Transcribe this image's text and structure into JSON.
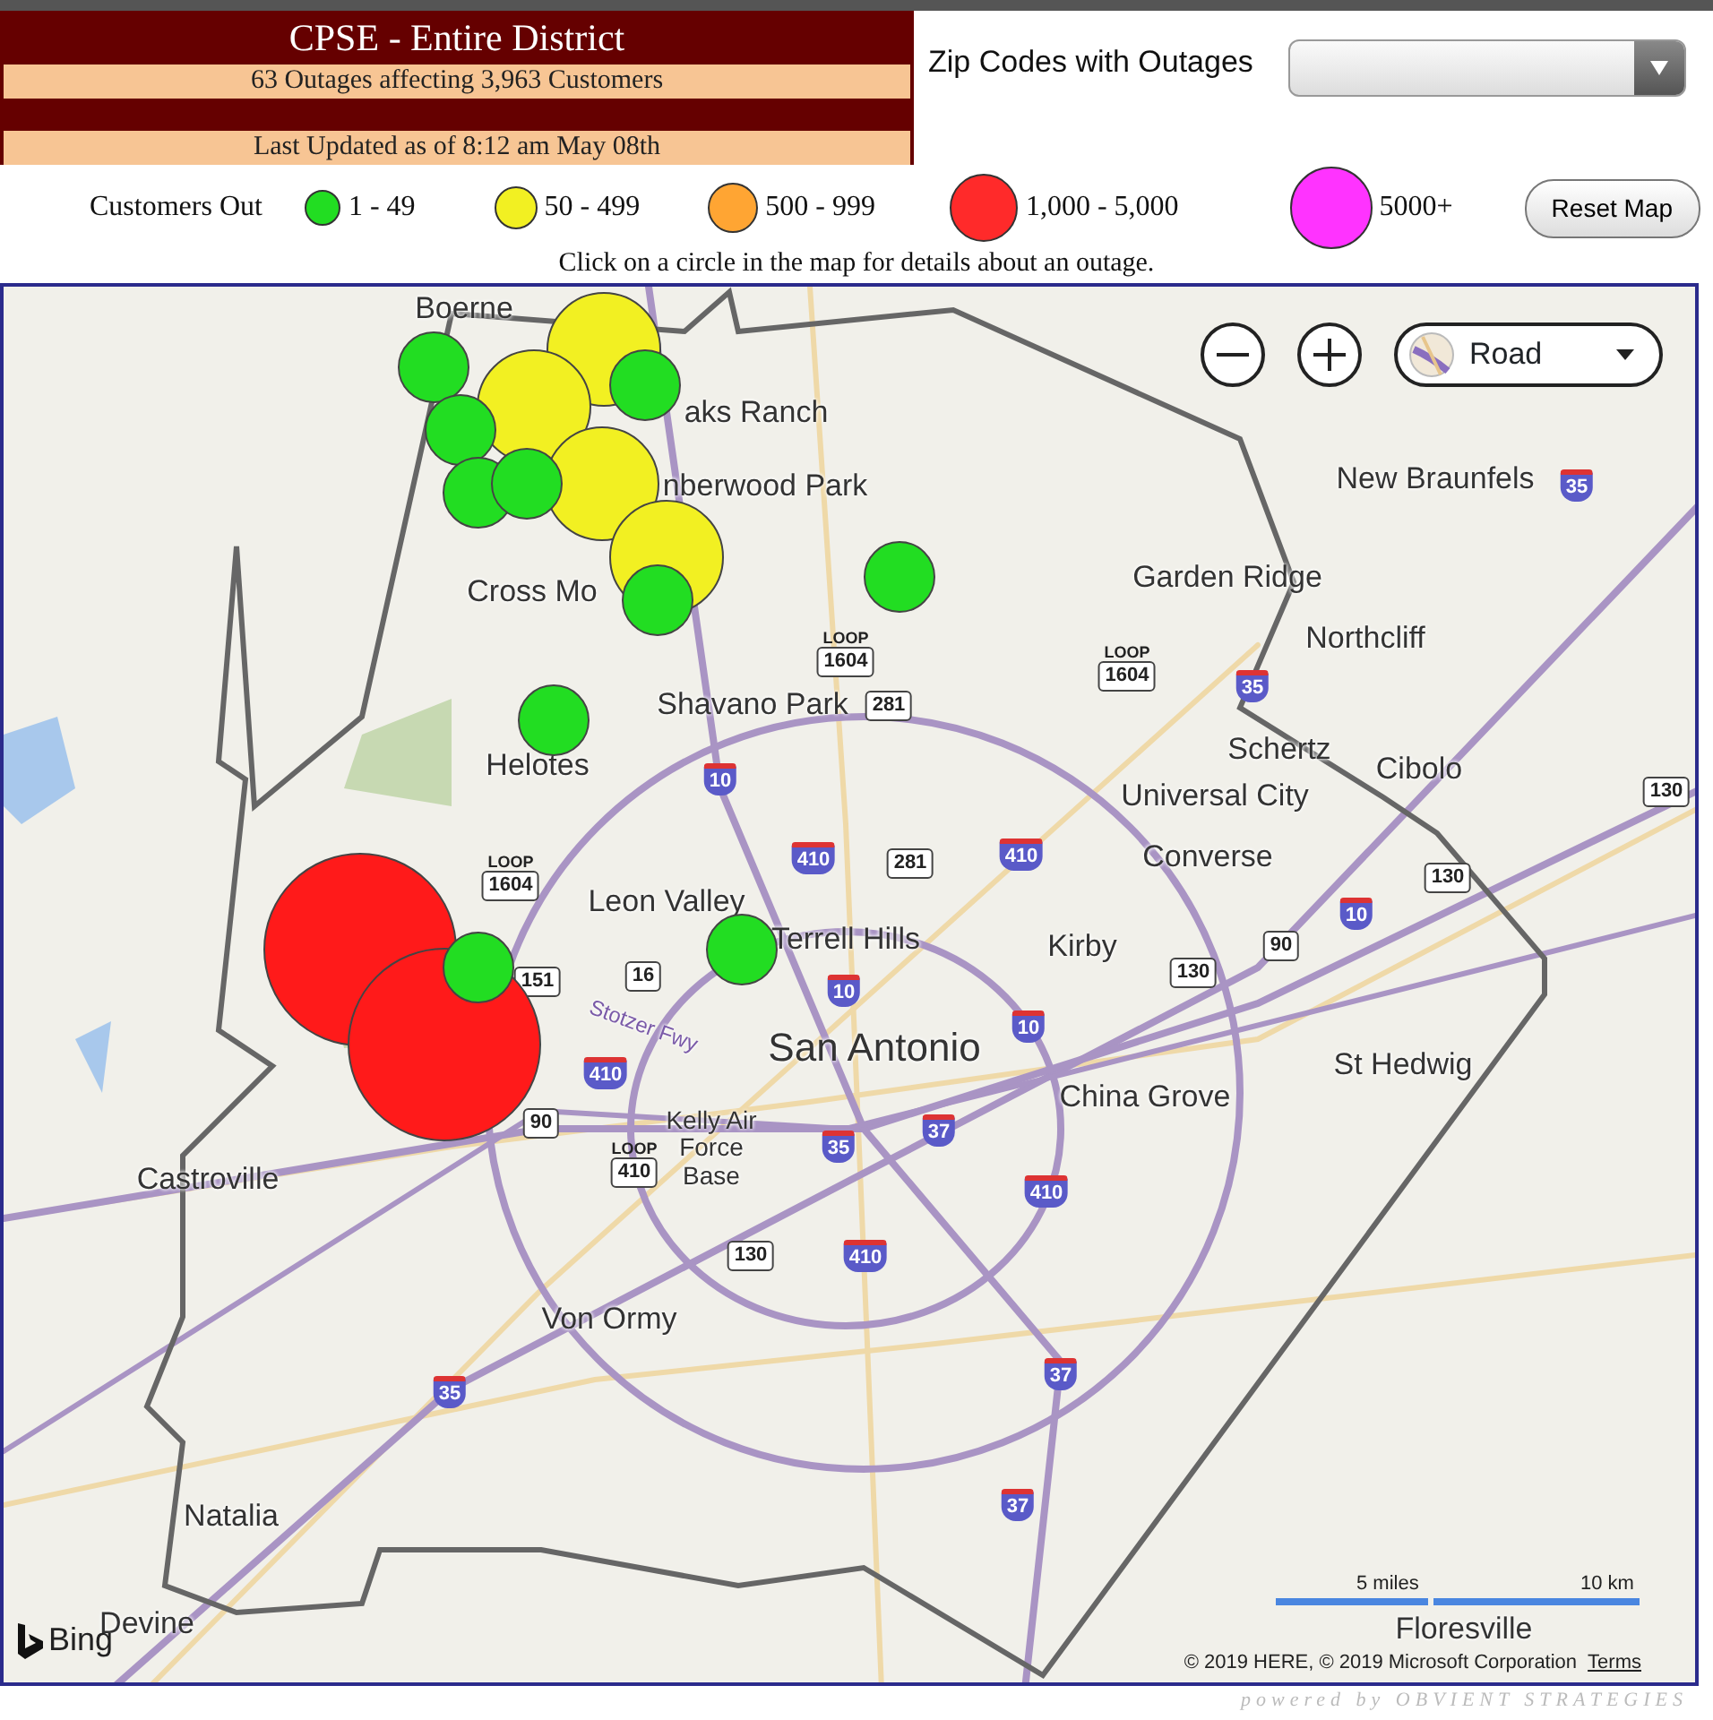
{
  "header": {
    "title": "CPSE - Entire District",
    "summary": "63 Outages affecting 3,963 Customers",
    "updated": "Last Updated as of 8:12 am May 08th"
  },
  "zip_filter": {
    "label": "Zip Codes with Outages"
  },
  "legend": {
    "title": "Customers Out",
    "items": [
      {
        "label": "1 - 49",
        "color": "#22dd22"
      },
      {
        "label": "50 - 499",
        "color": "#f2f022"
      },
      {
        "label": "500 - 999",
        "color": "#ffa533"
      },
      {
        "label": "1,000 - 5,000",
        "color": "#ff2a2a"
      },
      {
        "label": "5000+",
        "color": "#ff33ff"
      }
    ]
  },
  "reset_button": "Reset Map",
  "hint": "Click on a circle in the map for details about an outage.",
  "map": {
    "map_type": "Road",
    "places": [
      "Boerne",
      "aks Ranch",
      "nberwood Park",
      "Cross Mo",
      "Helotes",
      "New Braunfels",
      "Garden Ridge",
      "Northcliff",
      "Shavano Park",
      "Schertz",
      "Cibolo",
      "Universal City",
      "Converse",
      "Leon Valley",
      "Terrell Hills",
      "Kirby",
      "San Antonio",
      "St Hedwig",
      "China Grove",
      "Castroville",
      "Kelly Air Force Base",
      "Von Ormy",
      "Natalia",
      "Devine",
      "Floresville",
      "Stotzer Fwy"
    ],
    "shields": [
      {
        "text": "35",
        "kind": "interstate"
      },
      {
        "text": "1604",
        "kind": "loop",
        "prefix": "LOOP"
      },
      {
        "text": "1604",
        "kind": "loop",
        "prefix": "LOOP"
      },
      {
        "text": "281",
        "kind": "us"
      },
      {
        "text": "35",
        "kind": "interstate"
      },
      {
        "text": "130",
        "kind": "state"
      },
      {
        "text": "10",
        "kind": "interstate"
      },
      {
        "text": "410",
        "kind": "interstate"
      },
      {
        "text": "281",
        "kind": "us"
      },
      {
        "text": "410",
        "kind": "interstate"
      },
      {
        "text": "1604",
        "kind": "loop",
        "prefix": "LOOP"
      },
      {
        "text": "130",
        "kind": "state"
      },
      {
        "text": "10",
        "kind": "interstate"
      },
      {
        "text": "90",
        "kind": "us"
      },
      {
        "text": "130",
        "kind": "state"
      },
      {
        "text": "151",
        "kind": "state"
      },
      {
        "text": "16",
        "kind": "state"
      },
      {
        "text": "10",
        "kind": "interstate"
      },
      {
        "text": "10",
        "kind": "interstate"
      },
      {
        "text": "410",
        "kind": "interstate"
      },
      {
        "text": "90",
        "kind": "us"
      },
      {
        "text": "410",
        "kind": "loop",
        "prefix": "LOOP"
      },
      {
        "text": "35",
        "kind": "interstate"
      },
      {
        "text": "37",
        "kind": "interstate"
      },
      {
        "text": "410",
        "kind": "interstate"
      },
      {
        "text": "130",
        "kind": "state"
      },
      {
        "text": "410",
        "kind": "interstate"
      },
      {
        "text": "37",
        "kind": "interstate"
      },
      {
        "text": "35",
        "kind": "interstate"
      },
      {
        "text": "37",
        "kind": "interstate"
      }
    ],
    "outages": [
      {
        "kind": "small",
        "color": "#22dd22"
      },
      {
        "kind": "small",
        "color": "#22dd22"
      },
      {
        "kind": "small",
        "color": "#22dd22"
      },
      {
        "kind": "small",
        "color": "#22dd22"
      },
      {
        "kind": "small",
        "color": "#22dd22"
      },
      {
        "kind": "small",
        "color": "#22dd22"
      },
      {
        "kind": "small",
        "color": "#22dd22"
      },
      {
        "kind": "small",
        "color": "#22dd22"
      },
      {
        "kind": "small",
        "color": "#22dd22"
      },
      {
        "kind": "small",
        "color": "#22dd22"
      },
      {
        "kind": "medium",
        "color": "#f2f022"
      },
      {
        "kind": "medium",
        "color": "#f2f022"
      },
      {
        "kind": "medium",
        "color": "#f2f022"
      },
      {
        "kind": "medium",
        "color": "#f2f022"
      },
      {
        "kind": "large",
        "color": "#ff1a1a"
      },
      {
        "kind": "large",
        "color": "#ff1a1a"
      }
    ],
    "scale": {
      "miles": "5 miles",
      "km": "10 km"
    },
    "attribution": "© 2019 HERE, © 2019 Microsoft Corporation",
    "terms": "Terms",
    "logo": "Bing"
  },
  "footer": "powered by OBVIENT STRATEGIES"
}
